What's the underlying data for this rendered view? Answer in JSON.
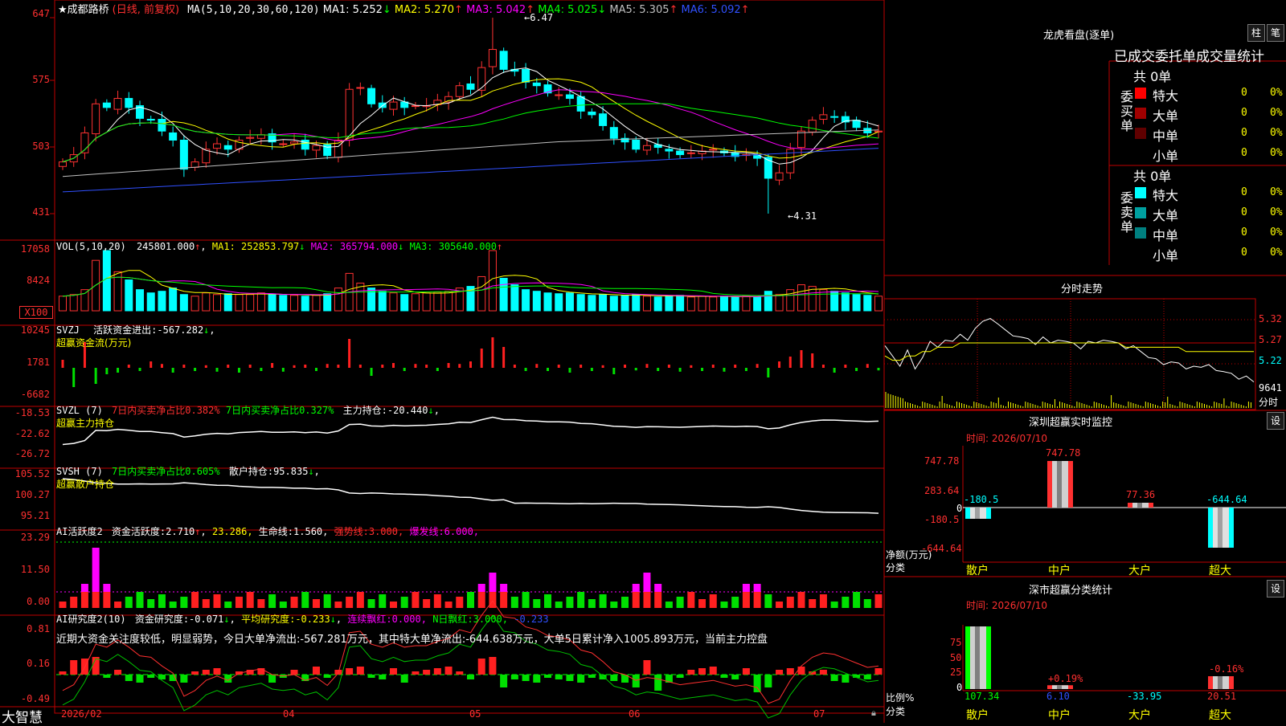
{
  "stock": {
    "star": "★",
    "name": "成都路桥",
    "period": "(日线, 前复权)",
    "ma_set": "MA(5,10,20,30,60,120)",
    "ma_values": [
      {
        "label": "MA1:",
        "value": "5.252",
        "arrow": "↓",
        "color": "#ffffff"
      },
      {
        "label": "MA2:",
        "value": "5.270",
        "arrow": "↑",
        "color": "#ffff00"
      },
      {
        "label": "MA3:",
        "value": "5.042",
        "arrow": "↑",
        "color": "#ff00ff"
      },
      {
        "label": "MA4:",
        "value": "5.025",
        "arrow": "↓",
        "color": "#00ff00"
      },
      {
        "label": "MA5:",
        "value": "5.305",
        "arrow": "↑",
        "color": "#c0c0c0"
      },
      {
        "label": "MA6:",
        "value": "5.092",
        "arrow": "↑",
        "color": "#3050ff"
      }
    ],
    "high_mark": "6.47",
    "low_mark": "4.31",
    "price_axis": [
      "647",
      "575",
      "503",
      "431"
    ]
  },
  "price_chart": {
    "closes": [
      4.88,
      4.96,
      5.2,
      5.52,
      5.48,
      5.58,
      5.48,
      5.36,
      5.34,
      5.22,
      5.12,
      4.8,
      4.88,
      5.02,
      5.08,
      5.02,
      5.12,
      5.15,
      5.18,
      5.1,
      5.08,
      5.1,
      5.02,
      5.06,
      4.95,
      5.12,
      5.68,
      5.7,
      5.52,
      5.48,
      5.54,
      5.48,
      5.5,
      5.5,
      5.56,
      5.6,
      5.72,
      5.68,
      5.92,
      6.12,
      5.9,
      5.88,
      5.76,
      5.72,
      5.64,
      5.62,
      5.58,
      5.44,
      5.4,
      5.28,
      5.14,
      5.1,
      5.02,
      5.06,
      5.04,
      5.0,
      4.96,
      4.98,
      5.0,
      5.02,
      4.98,
      4.94,
      4.96,
      4.92,
      4.7,
      4.76,
      5.02,
      5.22,
      5.34,
      5.4,
      5.38,
      5.32,
      5.26,
      5.2,
      5.22
    ]
  },
  "volume": {
    "header": "VOL(5,10,20)",
    "value": "245801.000",
    "ma": [
      {
        "label": "MA1:",
        "value": "252853.797",
        "arrow": "↓",
        "color": "#ffff00"
      },
      {
        "label": "MA2:",
        "value": "365794.000",
        "arrow": "↓",
        "color": "#ff00ff"
      },
      {
        "label": "MA3:",
        "value": "305640.000",
        "arrow": "↑",
        "color": "#00ff00"
      }
    ],
    "axis": [
      "17058",
      "8424",
      "X100"
    ],
    "values": [
      1.8,
      2.0,
      2.6,
      6.2,
      7.4,
      4.8,
      3.8,
      2.6,
      2.2,
      2.4,
      2.8,
      2.0,
      1.8,
      2.2,
      2.0,
      2.1,
      2.0,
      2.0,
      2.2,
      2.0,
      1.9,
      1.9,
      1.8,
      1.9,
      2.1,
      2.8,
      4.6,
      3.4,
      2.8,
      2.4,
      2.2,
      2.0,
      2.1,
      2.2,
      2.3,
      2.4,
      2.8,
      3.0,
      4.2,
      7.4,
      4.0,
      3.2,
      2.6,
      2.4,
      2.2,
      2.1,
      2.2,
      2.0,
      1.9,
      2.0,
      1.8,
      1.9,
      2.0,
      1.8,
      1.7,
      1.8,
      1.9,
      1.7,
      1.8,
      1.7,
      1.8,
      1.7,
      1.8,
      1.7,
      2.4,
      2.0,
      2.6,
      3.2,
      3.0,
      2.6,
      2.4,
      2.2,
      2.0,
      1.9,
      1.8
    ]
  },
  "svzj": {
    "header": "SVZJ",
    "desc": "活跃资金进出:",
    "value": "-567.282",
    "arrow": "↓",
    "subtitle": "超赢资金流(万元)",
    "axis": [
      "10245",
      "1781",
      "-6682"
    ],
    "values": [
      0.25,
      -0.6,
      0.8,
      -0.5,
      -0.2,
      -0.15,
      0.1,
      -0.1,
      0.2,
      0.12,
      -0.15,
      0.1,
      -0.1,
      0.08,
      -0.12,
      0.1,
      -0.15,
      0.1,
      -0.1,
      0.15,
      -0.12,
      0.08,
      0.1,
      -0.1,
      0.12,
      0.1,
      0.9,
      0.1,
      -0.25,
      0.1,
      0.15,
      -0.1,
      0.12,
      0.1,
      -0.1,
      0.15,
      0.12,
      0.2,
      0.6,
      0.95,
      0.65,
      0.1,
      -0.1,
      0.12,
      -0.1,
      0.1,
      -0.15,
      0.1,
      -0.1,
      0.08,
      -0.2,
      0.1,
      -0.08,
      0.12,
      -0.1,
      0.1,
      -0.12,
      0.08,
      -0.1,
      0.1,
      -0.12,
      0.1,
      -0.1,
      0.12,
      -0.3,
      0.2,
      0.35,
      0.55,
      0.45,
      0.1,
      -0.15,
      0.1,
      -0.1,
      0.12,
      -0.08
    ]
  },
  "svzl": {
    "header": "SVZL (7)",
    "ratio1": "7日内买卖净占比0.382%",
    "ratio2": "7日内买卖净占比0.327%",
    "desc": "主力持仓:",
    "value": "-20.440",
    "arrow": "↓",
    "subtitle": "超赢主力持仓",
    "axis": [
      "-18.53",
      "-22.62",
      "-26.72"
    ]
  },
  "svsh": {
    "header": "SVSH (7)",
    "ratio": "7日内买卖净占比0.605%",
    "desc": "散户持仓:",
    "value": "95.835",
    "arrow": "↓",
    "subtitle": "超赢散户持仓",
    "axis": [
      "105.52",
      "100.27",
      "95.21"
    ]
  },
  "ai_active": {
    "header": "AI活跃度2",
    "desc": "资金活跃度:",
    "value": "2.710",
    "value2": "23.286,",
    "life_label": "生命线:",
    "life_value": "1.560,",
    "strong_label": "强势线:",
    "strong_value": "3.000,",
    "burst_label": "爆发线:",
    "burst_value": "6.000,",
    "axis": [
      "23.29",
      "11.50",
      "0.00"
    ]
  },
  "ai_research": {
    "header": "AI研究度2(10)",
    "desc": "资金研究度:",
    "value": "-0.071",
    "avg_label": "平均研究度:",
    "avg_value": "-0.233",
    "cont_label": "连续飘红:",
    "cont_value": "0.000,",
    "n_label": "N日飘红:",
    "n_value": "3.000,",
    "last_value": "-0.233",
    "comment": "近期大资金关注度较低，明显弱势，今日大单净流出:-567.281万元，其中特大单净流出:-644.638万元，大单5日累计净入1005.893万元，当前主力控盘",
    "axis": [
      "0.81",
      "0.16",
      "-0.49"
    ]
  },
  "date_axis": [
    "2026/02",
    "04",
    "05",
    "06",
    "07"
  ],
  "brand": "大智慧",
  "dragon": {
    "title": "龙虎看盘(逐单)",
    "btn_bar": "柱",
    "btn_pen": "笔",
    "tabs": "已成交委托单成交量统计",
    "buy_side": "委买单",
    "sell_side": "委卖单",
    "buy_total": "共 0单",
    "sell_total": "共 0单",
    "buy_rows": [
      {
        "name": "特大",
        "n": "0",
        "pct": "0%",
        "color": "#ff0000"
      },
      {
        "name": "大单",
        "n": "0",
        "pct": "0%",
        "color": "#a00000"
      },
      {
        "name": "中单",
        "n": "0",
        "pct": "0%",
        "color": "#600000"
      },
      {
        "name": "小单",
        "n": "0",
        "pct": "0%",
        "color": "#000000"
      }
    ],
    "sell_rows": [
      {
        "name": "特大",
        "n": "0",
        "pct": "0%",
        "color": "#00ffff"
      },
      {
        "name": "大单",
        "n": "0",
        "pct": "0%",
        "color": "#00a0a0"
      },
      {
        "name": "中单",
        "n": "0",
        "pct": "0%",
        "color": "#008080"
      },
      {
        "name": "小单",
        "n": "0",
        "pct": "0%",
        "color": "#000000"
      }
    ]
  },
  "intraday": {
    "title": "分时走势",
    "axis": [
      "5.32",
      "5.27",
      "5.22",
      "9641"
    ],
    "axis_label": "分时",
    "prices": [
      5.26,
      5.24,
      5.22,
      5.25,
      5.21,
      5.24,
      5.27,
      5.26,
      5.28,
      5.27,
      5.29,
      5.28,
      5.3,
      5.32,
      5.33,
      5.31,
      5.3,
      5.29,
      5.28,
      5.28,
      5.27,
      5.28,
      5.27,
      5.28,
      5.27,
      5.27,
      5.26,
      5.27,
      5.27,
      5.28,
      5.27,
      5.27,
      5.26,
      5.26,
      5.25,
      5.24,
      5.23,
      5.22,
      5.23,
      5.22,
      5.21,
      5.22,
      5.21,
      5.22,
      5.21,
      5.2,
      5.2,
      5.19,
      5.19,
      5.18
    ],
    "avg": [
      5.24,
      5.23,
      5.23,
      5.24,
      5.24,
      5.25,
      5.25,
      5.26,
      5.26,
      5.26,
      5.27,
      5.27,
      5.27,
      5.27,
      5.27,
      5.27,
      5.27,
      5.27,
      5.27,
      5.27,
      5.27,
      5.27,
      5.27,
      5.27,
      5.27,
      5.27,
      5.27,
      5.27,
      5.27,
      5.27,
      5.27,
      5.27,
      5.26,
      5.26,
      5.26,
      5.26,
      5.26,
      5.26,
      5.26,
      5.26,
      5.25,
      5.25,
      5.25,
      5.25,
      5.25,
      5.25,
      5.25,
      5.25,
      5.25,
      5.25
    ]
  },
  "monitor": {
    "title": "深圳超赢实时监控",
    "btn": "设",
    "date": "时间: 2026/07/10",
    "axis": [
      "747.78",
      "283.64",
      "0",
      "-180.5",
      "-644.64"
    ],
    "y_label": "净额(万元)",
    "x_label": "分类",
    "cats": [
      "散户",
      "中户",
      "大户",
      "超大"
    ],
    "values": [
      -180.5,
      747.78,
      77.36,
      -644.64
    ],
    "value_labels": [
      "-180.5",
      "747.78",
      "77.36",
      "-644.64"
    ],
    "ylim": [
      -644.64,
      747.78
    ]
  },
  "stats": {
    "title": "深市超赢分类统计",
    "btn": "设",
    "date": "时间: 2026/07/10",
    "axis": [
      "75",
      "50",
      "25",
      "0"
    ],
    "y_label": "比例%",
    "x_label": "分类",
    "cats": [
      "散户",
      "中户",
      "大户",
      "超大"
    ],
    "values": [
      107.34,
      6.1,
      -33.95,
      20.51
    ],
    "value_labels": [
      "107.34",
      "6.10",
      "-33.95",
      "20.51"
    ],
    "changes": [
      "",
      "+0.19%",
      "",
      "-0.16%"
    ]
  },
  "colors": {
    "up": "#ff3232",
    "down": "#00ffff",
    "grid": "#c00000",
    "accent_yellow": "#ffff00",
    "accent_magenta": "#ff00ff",
    "accent_green": "#00ff00"
  }
}
